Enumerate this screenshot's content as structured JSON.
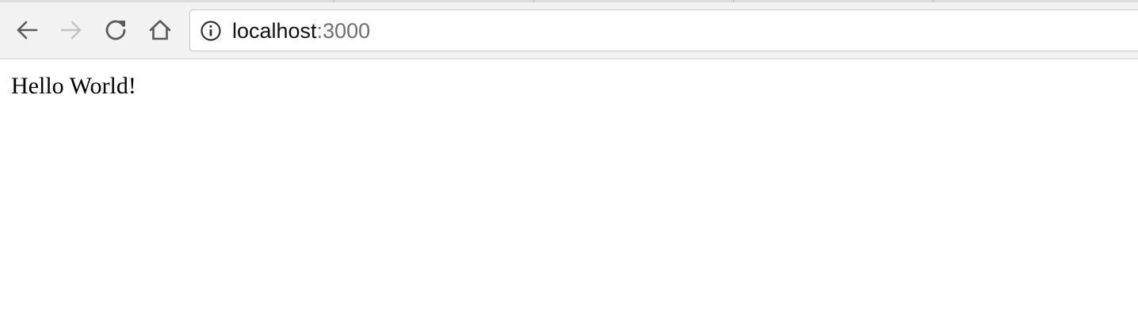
{
  "browser": {
    "toolbar": {
      "buttons": [
        {
          "name": "back",
          "icon": "arrow-left-icon",
          "enabled": true
        },
        {
          "name": "forward",
          "icon": "arrow-right-icon",
          "enabled": false
        },
        {
          "name": "reload",
          "icon": "reload-icon",
          "enabled": true
        },
        {
          "name": "home",
          "icon": "home-icon",
          "enabled": true
        }
      ]
    },
    "address_bar": {
      "security_icon": "info-circle-icon",
      "host": "localhost",
      "port": ":3000"
    }
  },
  "page": {
    "content": "Hello World!"
  },
  "colors": {
    "toolbar_bg": "#f2f2f2",
    "icon_enabled": "#5a5a5a",
    "icon_disabled": "#c4c4c4",
    "port_text": "#6f6f6f"
  }
}
